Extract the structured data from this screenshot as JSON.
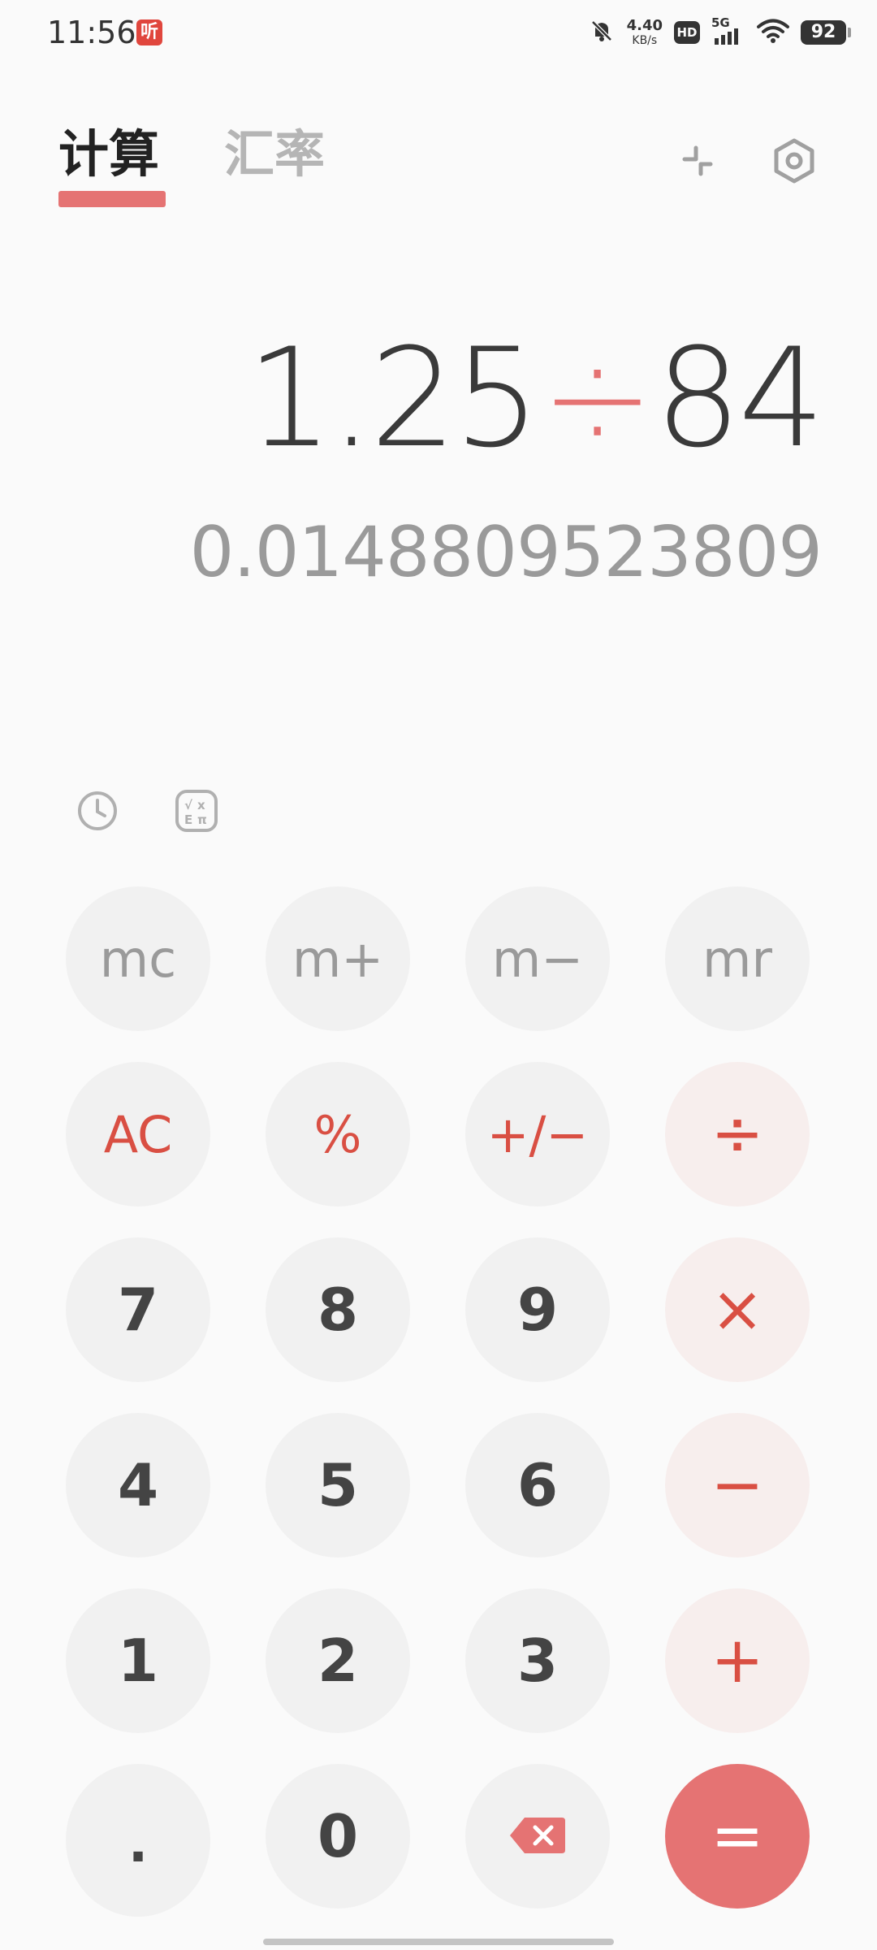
{
  "status_bar": {
    "time": "11:56",
    "notification_badge": "听",
    "net_speed_value": "4.40",
    "net_speed_unit": "KB/s",
    "hd_label": "HD",
    "network_type": "5G",
    "battery": "92"
  },
  "tabs": {
    "calculate": "计算",
    "exchange_rate": "汇率"
  },
  "colors": {
    "accent": "#e57373",
    "operator_text": "#d94f43",
    "background": "#fafafa",
    "key_bg": "#f1f1f1",
    "operator_key_bg": "#f7eeed"
  },
  "display": {
    "operand1": "1.25",
    "operator": "÷",
    "operand2": "84",
    "result": "0.0148809523809"
  },
  "icons": {
    "collapse": "collapse-icon",
    "settings": "settings-hexagon-icon",
    "history": "history-clock-icon",
    "scientific": "scientific-mode-icon",
    "backspace": "backspace-icon"
  },
  "keypad": {
    "mc": "mc",
    "mplus": "m+",
    "mminus": "m−",
    "mr": "mr",
    "ac": "AC",
    "percent": "%",
    "negate": "+/−",
    "divide": "÷",
    "seven": "7",
    "eight": "8",
    "nine": "9",
    "multiply": "×",
    "four": "4",
    "five": "5",
    "six": "6",
    "minus": "−",
    "one": "1",
    "two": "2",
    "three": "3",
    "plus": "+",
    "dot": ".",
    "zero": "0",
    "equals": "="
  }
}
